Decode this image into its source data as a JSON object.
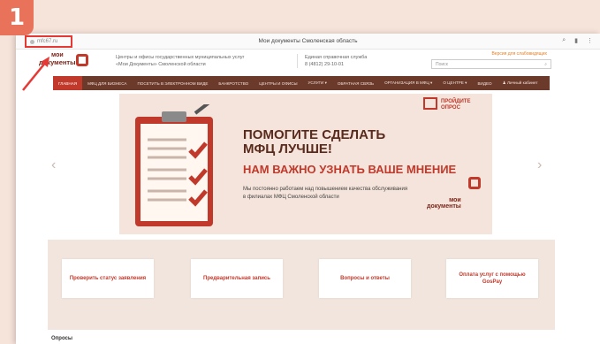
{
  "step_number": "1",
  "browser": {
    "url": "mfc67.ru",
    "window_title": "Мои документы Смоленская область"
  },
  "header": {
    "logo_line1": "мои",
    "logo_line2": "документы",
    "center_line1": "Центры и офисы государственных муниципальных услуг",
    "center_line2": "«Мои Документы» Смоленской области",
    "help_line1": "Единая справочная служба",
    "help_line2": "8 (4812) 29-10-01",
    "vision_link": "Версия для слабовидящих",
    "search_placeholder": "Поиск"
  },
  "nav": {
    "items": [
      "ГЛАВНАЯ",
      "МФЦ ДЛЯ БИЗНЕСА",
      "ПОСЕТИТЬ В ЭЛЕКТРОННОМ ВИДЕ",
      "БАНКРОТСТВО",
      "ЦЕНТРЫ И ОФИСЫ",
      "УСЛУГИ ▾",
      "ОБРАТНАЯ СВЯЗЬ",
      "ОРГАНИЗАЦИЯ В МФЦ ▾",
      "О ЦЕНТРЕ ▾",
      "ВИДЕО",
      "♟ Личный кабинет"
    ]
  },
  "banner": {
    "title_line1": "ПОМОГИТЕ СДЕЛАТЬ",
    "title_line2": "МФЦ ЛУЧШЕ!",
    "subtitle": "НАМ ВАЖНО УЗНАТЬ ВАШЕ МНЕНИЕ",
    "text_line1": "Мы постоянно работаем над повышением качества обслуживания",
    "text_line2": "в филиалах МФЦ Смоленской области",
    "survey_line1": "ПРОЙДИТЕ",
    "survey_line2": "ОПРОС",
    "logo_line1": "мои",
    "logo_line2": "документы"
  },
  "services": [
    "Проверить статус заявления",
    "Предварительная запись",
    "Вопросы и ответы",
    "Оплата услуг с помощью GosPay"
  ],
  "bottom_label": "Опросы",
  "colors": {
    "accent": "#c0392b",
    "nav_bg": "#6b3a2a",
    "page_bg": "#f6e3da"
  }
}
